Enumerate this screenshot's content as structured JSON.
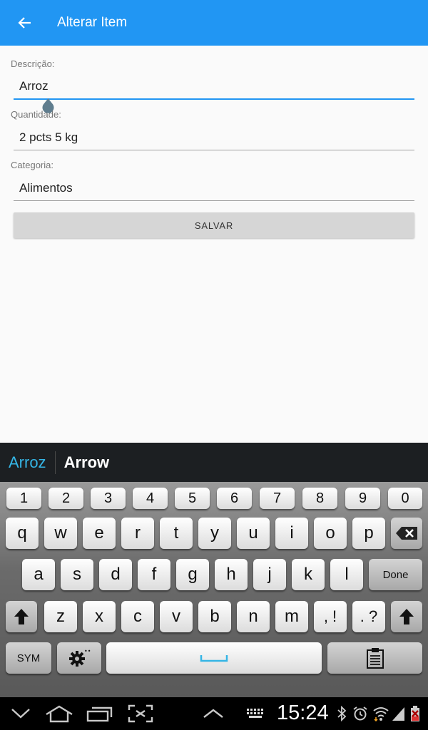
{
  "appbar": {
    "title": "Alterar Item"
  },
  "form": {
    "descricao_label": "Descrição:",
    "descricao_value": "Arroz",
    "quantidade_label": "Quantidade:",
    "quantidade_value": "2 pcts 5 kg",
    "categoria_label": "Categoria:",
    "categoria_value": "Alimentos",
    "save_label": "SALVAR"
  },
  "keyboard": {
    "suggestions": [
      "Arroz",
      "Arrow"
    ],
    "row_numbers": [
      "1",
      "2",
      "3",
      "4",
      "5",
      "6",
      "7",
      "8",
      "9",
      "0"
    ],
    "row1": [
      "q",
      "w",
      "e",
      "r",
      "t",
      "y",
      "u",
      "i",
      "o",
      "p"
    ],
    "row2": [
      "a",
      "s",
      "d",
      "f",
      "g",
      "h",
      "j",
      "k",
      "l"
    ],
    "done_label": "Done",
    "row3": [
      "z",
      "x",
      "c",
      "v",
      "b",
      "n",
      "m"
    ],
    "comma_label": ", !",
    "period_label": ". ?",
    "sym_label": "SYM"
  },
  "statusbar": {
    "time": "15:24"
  },
  "colors": {
    "accent": "#2196f3",
    "suggestion": "#35b5e5"
  }
}
